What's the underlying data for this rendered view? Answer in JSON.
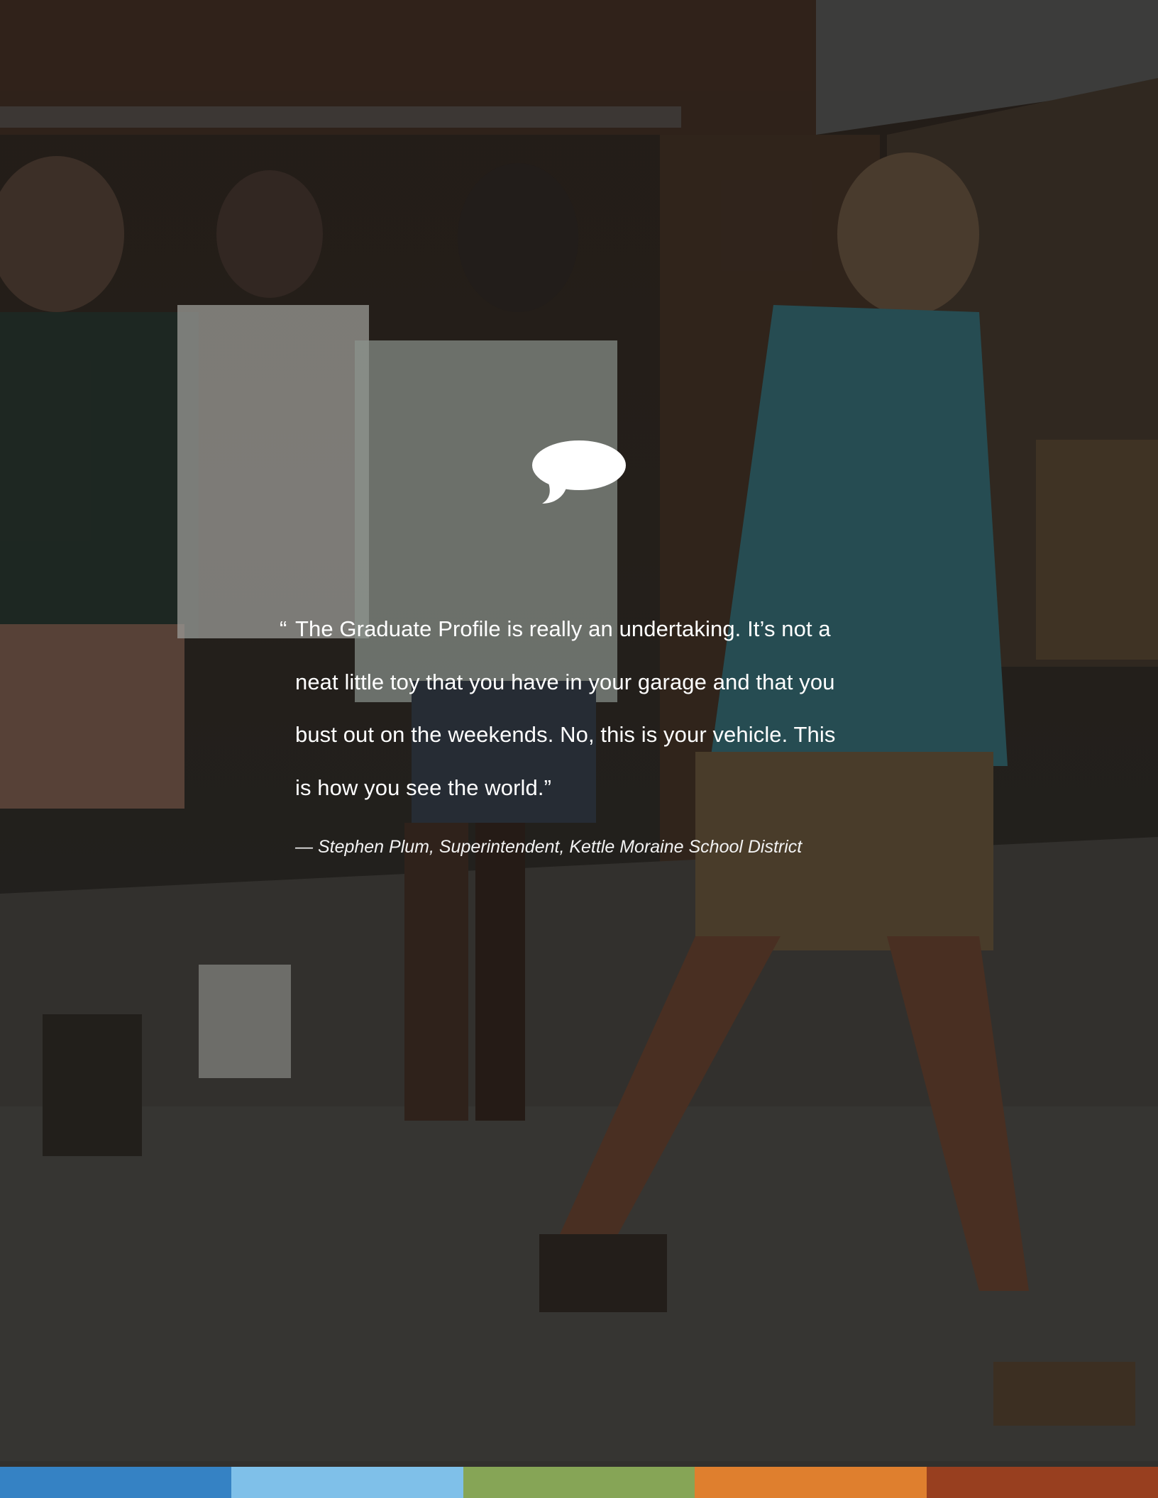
{
  "quote": {
    "open_mark": "“",
    "lines": [
      "The Graduate Profile is really an undertaking. It’s not a",
      "neat little toy that you have in your garage and that you",
      "bust out on the weekends. No, this is your vehicle. This",
      "is how you see the world.”"
    ]
  },
  "attribution": "— Stephen Plum, Superintendent, Kettle Moraine School District",
  "icons": {
    "speech_bubble": "speech-bubble-icon"
  },
  "colors": {
    "bar_segments": [
      "#3582c4",
      "#7fc0e9",
      "#86a556",
      "#df7f2e",
      "#983f1f"
    ],
    "text": "#ffffff"
  }
}
